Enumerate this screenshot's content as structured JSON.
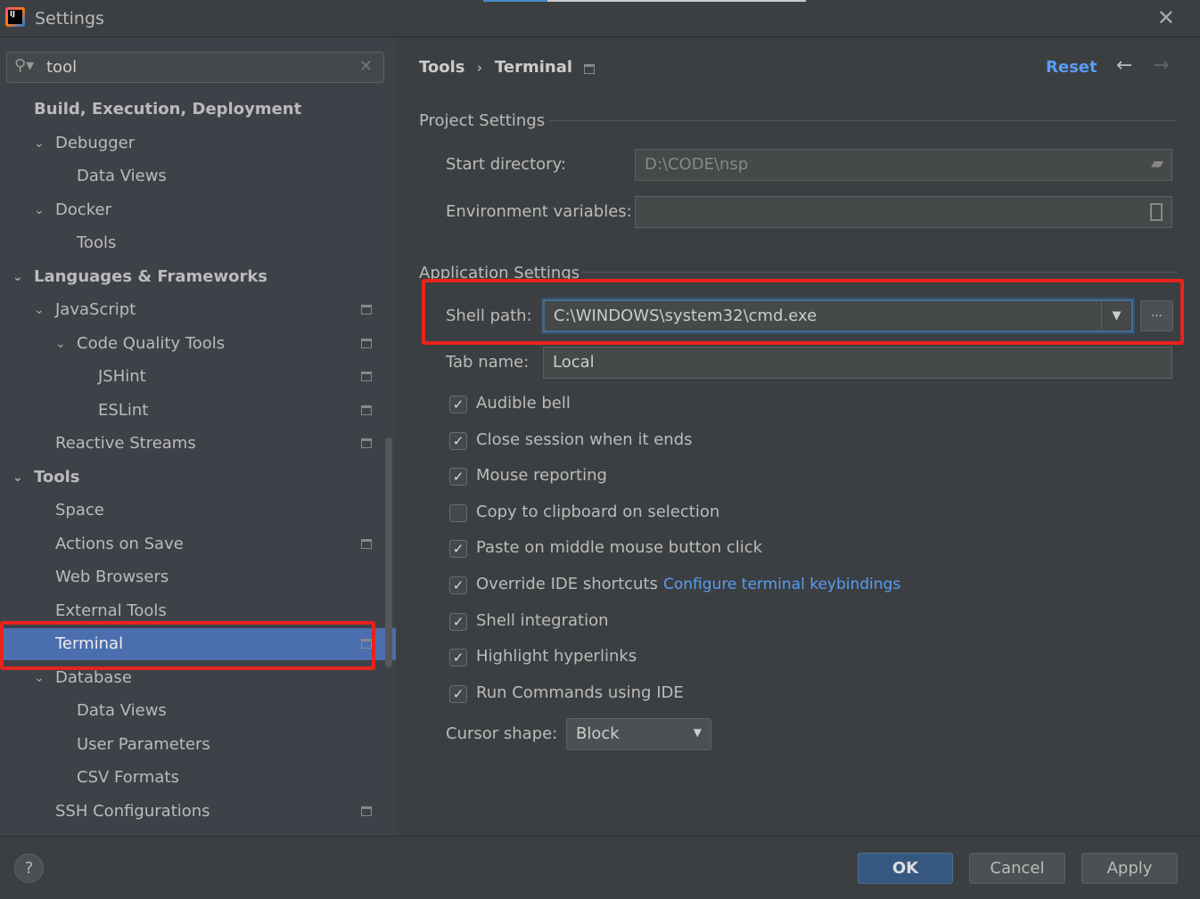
{
  "window": {
    "title": "Settings",
    "close_icon": "close-icon"
  },
  "search": {
    "value": "tool"
  },
  "sidebar": {
    "items": [
      {
        "label": "Build, Execution, Deployment",
        "level": 0,
        "bold": true,
        "chevron": false,
        "icon": false
      },
      {
        "label": "Debugger",
        "level": 1,
        "chevron": true,
        "icon": false
      },
      {
        "label": "Data Views",
        "level": 2,
        "icon": false
      },
      {
        "label": "Docker",
        "level": 1,
        "chevron": true,
        "icon": false
      },
      {
        "label": "Tools",
        "level": 2,
        "icon": false
      },
      {
        "label": "Languages & Frameworks",
        "level": 0,
        "bold": true,
        "chevron": true,
        "icon": false
      },
      {
        "label": "JavaScript",
        "level": 1,
        "chevron": true,
        "icon": true
      },
      {
        "label": "Code Quality Tools",
        "level": 2,
        "chevron": true,
        "icon": true
      },
      {
        "label": "JSHint",
        "level": 3,
        "icon": true
      },
      {
        "label": "ESLint",
        "level": 3,
        "icon": true
      },
      {
        "label": "Reactive Streams",
        "level": 1,
        "icon": true
      },
      {
        "label": "Tools",
        "level": 0,
        "bold": true,
        "chevron": true,
        "icon": false
      },
      {
        "label": "Space",
        "level": 1,
        "icon": false
      },
      {
        "label": "Actions on Save",
        "level": 1,
        "icon": true
      },
      {
        "label": "Web Browsers",
        "level": 1,
        "icon": false
      },
      {
        "label": "External Tools",
        "level": 1,
        "icon": false
      },
      {
        "label": "Terminal",
        "level": 1,
        "icon": true,
        "selected": true
      },
      {
        "label": "Database",
        "level": 1,
        "chevron": true,
        "icon": false
      },
      {
        "label": "Data Views",
        "level": 2,
        "icon": false
      },
      {
        "label": "User Parameters",
        "level": 2,
        "icon": false
      },
      {
        "label": "CSV Formats",
        "level": 2,
        "icon": false
      },
      {
        "label": "SSH Configurations",
        "level": 1,
        "icon": true
      }
    ]
  },
  "header": {
    "crumb1": "Tools",
    "separator": "›",
    "crumb2": "Terminal",
    "reset": "Reset"
  },
  "project": {
    "title": "Project Settings",
    "start_dir_label": "Start directory:",
    "start_dir_value": "D:\\CODE\\nsp",
    "env_label": "Environment variables:",
    "env_value": ""
  },
  "app": {
    "title": "Application Settings",
    "shell_label": "Shell path:",
    "shell_value": "C:\\WINDOWS\\system32\\cmd.exe",
    "browse": "...",
    "tab_label": "Tab name:",
    "tab_value": "Local",
    "checkboxes": [
      {
        "label": "Audible bell",
        "checked": true
      },
      {
        "label": "Close session when it ends",
        "checked": true
      },
      {
        "label": "Mouse reporting",
        "checked": true
      },
      {
        "label": "Copy to clipboard on selection",
        "checked": false
      },
      {
        "label": "Paste on middle mouse button click",
        "checked": true
      },
      {
        "label": "Override IDE shortcuts",
        "checked": true
      },
      {
        "label": "Shell integration",
        "checked": true
      },
      {
        "label": "Highlight hyperlinks",
        "checked": true
      },
      {
        "label": "Run Commands using IDE",
        "checked": true
      }
    ],
    "keybindings_link": "Configure terminal keybindings",
    "cursor_label": "Cursor shape:",
    "cursor_value": "Block"
  },
  "footer": {
    "help": "?",
    "ok": "OK",
    "cancel": "Cancel",
    "apply": "Apply"
  },
  "colors": {
    "accent": "#4b6eaf",
    "link": "#589df6",
    "highlight": "#e8231d"
  }
}
